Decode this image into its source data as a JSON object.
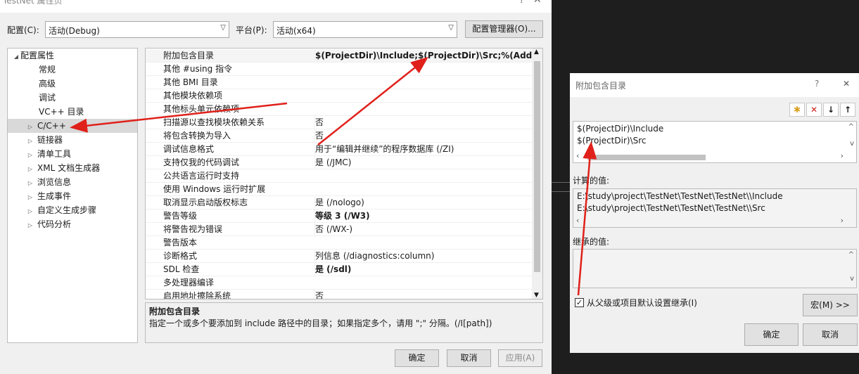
{
  "window": {
    "title": "TestNet 属性页",
    "help_glyph": "?",
    "close_glyph": "✕"
  },
  "config_row": {
    "config_label": "配置(C):",
    "config_value": "活动(Debug)",
    "platform_label": "平台(P):",
    "platform_value": "活动(x64)",
    "config_manager_label": "配置管理器(O)..."
  },
  "tree": {
    "root_label": "配置属性",
    "items": [
      {
        "label": "常规"
      },
      {
        "label": "高级"
      },
      {
        "label": "调试"
      },
      {
        "label": "VC++ 目录"
      },
      {
        "label": "C/C++"
      },
      {
        "label": "链接器"
      },
      {
        "label": "清单工具"
      },
      {
        "label": "XML 文档生成器"
      },
      {
        "label": "浏览信息"
      },
      {
        "label": "生成事件"
      },
      {
        "label": "自定义生成步骤"
      },
      {
        "label": "代码分析"
      }
    ]
  },
  "properties": [
    {
      "name": "附加包含目录",
      "value": "$(ProjectDir)\\Include;$(ProjectDir)\\Src;%(Addition"
    },
    {
      "name": "其他 #using 指令",
      "value": ""
    },
    {
      "name": "其他 BMI 目录",
      "value": ""
    },
    {
      "name": "其他模块依赖项",
      "value": ""
    },
    {
      "name": "其他标头单元依赖项",
      "value": ""
    },
    {
      "name": "扫描源以查找模块依赖关系",
      "value": "否"
    },
    {
      "name": "将包含转换为导入",
      "value": "否"
    },
    {
      "name": "调试信息格式",
      "value": "用于“编辑并继续”的程序数据库 (/ZI)"
    },
    {
      "name": "支持仅我的代码调试",
      "value": "是 (/JMC)"
    },
    {
      "name": "公共语言运行时支持",
      "value": ""
    },
    {
      "name": "使用 Windows 运行时扩展",
      "value": ""
    },
    {
      "name": "取消显示启动版权标志",
      "value": "是 (/nologo)"
    },
    {
      "name": "警告等级",
      "value": "等级 3 (/W3)"
    },
    {
      "name": "将警告视为错误",
      "value": "否 (/WX-)"
    },
    {
      "name": "警告版本",
      "value": ""
    },
    {
      "name": "诊断格式",
      "value": "列信息 (/diagnostics:column)"
    },
    {
      "name": "SDL 检查",
      "value": "是 (/sdl)"
    },
    {
      "name": "多处理器编译",
      "value": ""
    },
    {
      "name": "启用地址擦除系统",
      "value": "否"
    }
  ],
  "description": {
    "title": "附加包含目录",
    "text": "指定一个或多个要添加到 include 路径中的目录；如果指定多个，请用 \";\" 分隔。(/I[path])"
  },
  "bottom_buttons": {
    "ok": "确定",
    "cancel": "取消",
    "apply": "应用(A)"
  },
  "include_dialog": {
    "title": "附加包含目录",
    "help_glyph": "?",
    "close_glyph": "✕",
    "entries": [
      "$(ProjectDir)\\Include",
      "$(ProjectDir)\\Src"
    ],
    "evaluated_label": "计算的值:",
    "evaluated": [
      "E:\\study\\project\\TestNet\\TestNet\\TestNet\\\\Include",
      "E:\\study\\project\\TestNet\\TestNet\\TestNet\\\\Src"
    ],
    "inherited_label": "继承的值:",
    "inherit_checkbox_label": "从父级或项目默认设置继承(I)",
    "inherit_checked": true,
    "macros_button": "宏(M) >>",
    "ok": "确定",
    "cancel": "取消"
  },
  "colors": {
    "annotation_arrow": "#e0201a",
    "selected_row": "#d9d9d9",
    "dialog_bg": "#f0f0f0"
  }
}
